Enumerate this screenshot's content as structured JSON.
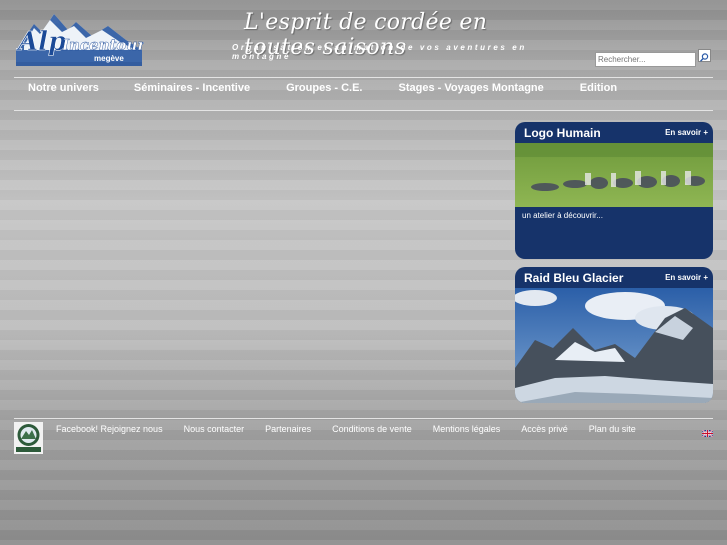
{
  "header": {
    "logo_text": "Alp Incentour",
    "logo_subtext": "megève",
    "tagline": "L'esprit de cordée en toutes saisons",
    "subtagline": "Organisation et animation de vos aventures en montagne"
  },
  "search": {
    "placeholder": "Rechercher..."
  },
  "nav": {
    "items": [
      {
        "label": "Notre univers"
      },
      {
        "label": "Séminaires - Incentive"
      },
      {
        "label": "Groupes - C.E."
      },
      {
        "label": "Stages - Voyages Montagne"
      },
      {
        "label": "Edition"
      }
    ]
  },
  "cards": [
    {
      "title": "Logo Humain",
      "more": "En savoir +",
      "text": "un atelier à découvrir..."
    },
    {
      "title": "Raid Bleu Glacier",
      "more": "En savoir +",
      "text": ""
    }
  ],
  "footer": {
    "links": [
      {
        "label": "Facebook! Rejoignez nous"
      },
      {
        "label": "Nous contacter"
      },
      {
        "label": "Partenaires"
      },
      {
        "label": "Conditions de vente"
      },
      {
        "label": "Mentions légales"
      },
      {
        "label": "Accès privé"
      },
      {
        "label": "Plan du site"
      }
    ]
  },
  "colors": {
    "card_bg": "#16336a",
    "logo_blue": "#2a5ba8"
  }
}
